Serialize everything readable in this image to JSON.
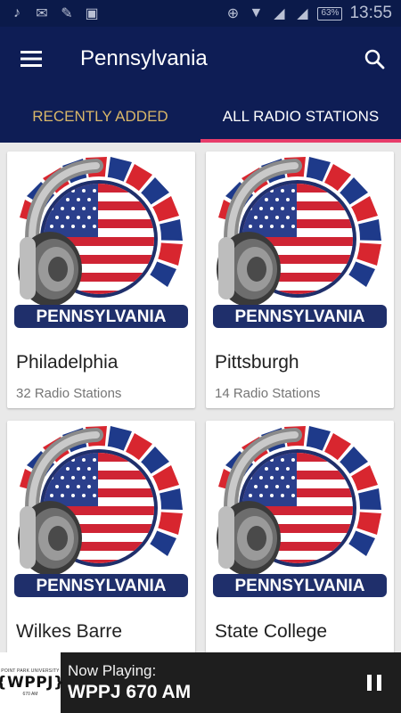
{
  "status_bar": {
    "time": "13:55",
    "battery": "63%",
    "icons": [
      "music-note-icon",
      "email-icon",
      "clean-icon",
      "image-icon",
      "data-saver-icon",
      "wifi-icon",
      "signal-icon",
      "signal-icon"
    ]
  },
  "app_bar": {
    "title": "Pennsylvania",
    "menu_icon": "hamburger-menu-icon",
    "search_icon": "search-icon"
  },
  "tabs": [
    {
      "label": "RECENTLY ADDED",
      "active": false
    },
    {
      "label": "ALL RADIO STATIONS",
      "active": true
    }
  ],
  "cards": [
    {
      "name": "Philadelphia",
      "count": "32 Radio Stations",
      "banner": "PENNSYLVANIA"
    },
    {
      "name": "Pittsburgh",
      "count": "14 Radio Stations",
      "banner": "PENNSYLVANIA"
    },
    {
      "name": "Wilkes Barre",
      "count": "",
      "banner": "PENNSYLVANIA"
    },
    {
      "name": "State College",
      "count": "",
      "banner": "PENNSYLVANIA"
    }
  ],
  "player": {
    "label": "Now Playing:",
    "station": "WPPJ 670 AM",
    "logo_text": "{WPPJ}",
    "logo_top": "POINT PARK UNIVERSITY",
    "logo_bottom": "670 AM",
    "control_icon": "pause-icon"
  },
  "colors": {
    "status_bar": "#0b1a4a",
    "app_bar": "#0e1d55",
    "tab_indicator": "#e83d6b",
    "inactive_tab_text": "#d9b769",
    "player_bg": "#1e1e1e"
  }
}
